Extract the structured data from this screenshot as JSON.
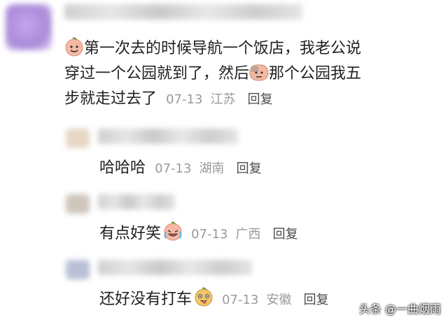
{
  "comment": {
    "line1": "第一次去的时候导航一个饭店，我老公说",
    "line2": "穿过一个公园就到了，然后",
    "line3_text": "那个公园我五",
    "line3b": "步就走过去了",
    "date": "07-13",
    "location": "江苏",
    "reply_label": "回复",
    "emoji_start": "smile-peach-icon",
    "emoji_mid": "sweat-peach-icon"
  },
  "replies": [
    {
      "text": "哈哈哈",
      "date": "07-13",
      "location": "湖南",
      "reply_label": "回复"
    },
    {
      "text": "有点好笑",
      "date": "07-13",
      "location": "广西",
      "reply_label": "回复",
      "emoji": "laugh-cry-peach-icon"
    },
    {
      "text": "还好没有打车",
      "date": "07-13",
      "location": "安徽",
      "reply_label": "回复",
      "emoji": "tongue-peach-icon"
    }
  ],
  "watermark": "头条 @一曲烟雨",
  "colors": {
    "meta": "#9a9a9a",
    "text": "#1f1f1f",
    "avatar_main": "#b695e0"
  }
}
